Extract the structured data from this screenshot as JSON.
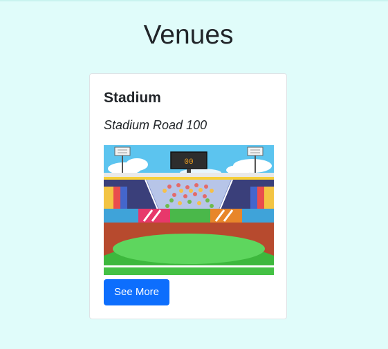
{
  "page": {
    "title": "Venues"
  },
  "venue_card": {
    "name": "Stadium",
    "address": "Stadium Road 100",
    "image_icon": "stadium-illustration",
    "scoreboard_text": "00",
    "button_label": "See More",
    "button_color": "#0d6efd",
    "background_color": "#e0fcfa"
  }
}
